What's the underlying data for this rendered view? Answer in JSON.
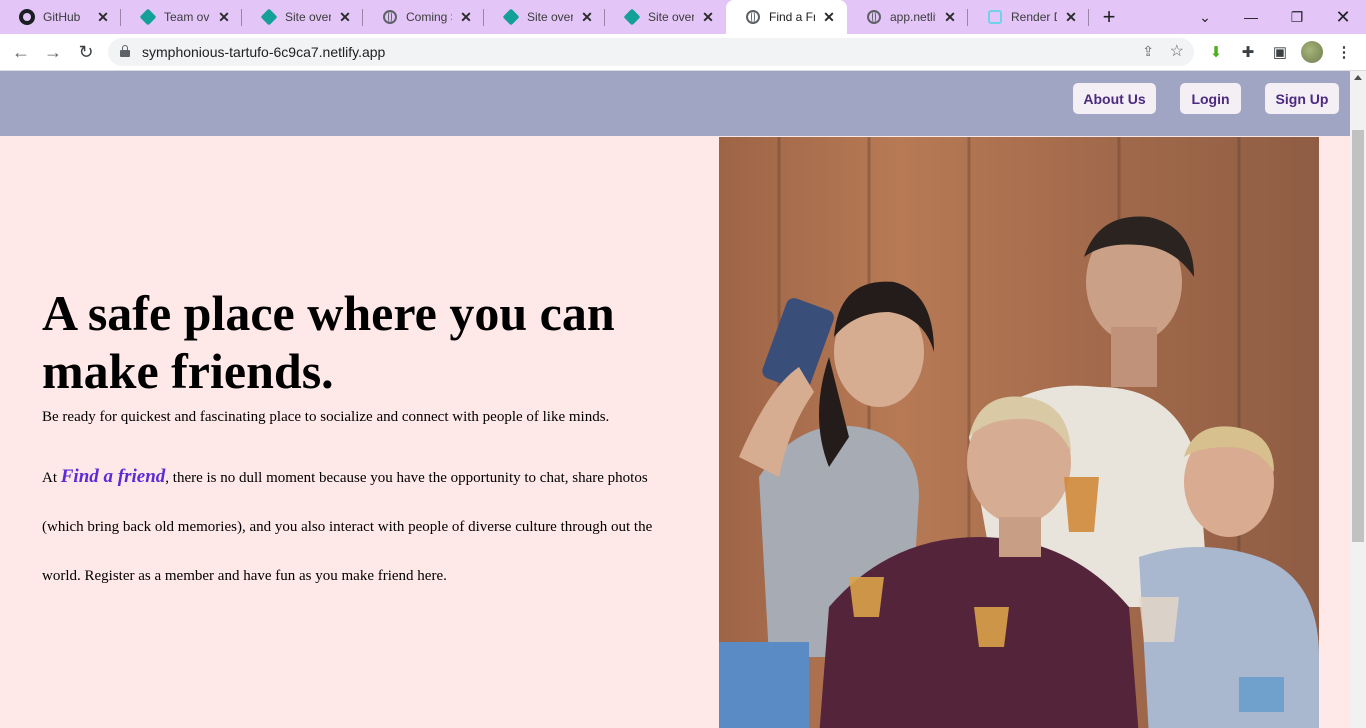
{
  "browser": {
    "tabs": [
      {
        "title": "GitHub",
        "favicon": "github-icon"
      },
      {
        "title": "Team overview",
        "favicon": "netlify-icon"
      },
      {
        "title": "Site overview",
        "favicon": "netlify-icon"
      },
      {
        "title": "Coming Soon",
        "favicon": "globe-icon"
      },
      {
        "title": "Site overview",
        "favicon": "netlify-icon"
      },
      {
        "title": "Site overview",
        "favicon": "netlify-icon"
      },
      {
        "title": "Find a Friend",
        "favicon": "globe-icon",
        "active": true
      },
      {
        "title": "app.netlify",
        "favicon": "globe-icon"
      },
      {
        "title": "Render Dashboard",
        "favicon": "render-icon"
      }
    ],
    "url": "symphonious-tartufo-6c9ca7.netlify.app"
  },
  "nav": {
    "about": "About Us",
    "login": "Login",
    "signup": "Sign Up"
  },
  "hero": {
    "headline": "A safe place where you can make friends.",
    "para1": "Be ready for quickest and fascinating place to socialize and connect with people of like minds.",
    "para2_prefix": "At ",
    "brand": "Find a friend",
    "para2_suffix": ", there is no dull moment because you have the opportunity to chat, share photos (which bring back old memories), and you also interact with people of diverse culture through out the world. Register as a member and have fun as you make friend here."
  },
  "colors": {
    "tabstrip": "#e3c6f7",
    "navbar": "#9fa5c2",
    "page_bg": "#ffe8e8",
    "button_text": "#4b2a80",
    "brand": "#5a2bd6"
  }
}
